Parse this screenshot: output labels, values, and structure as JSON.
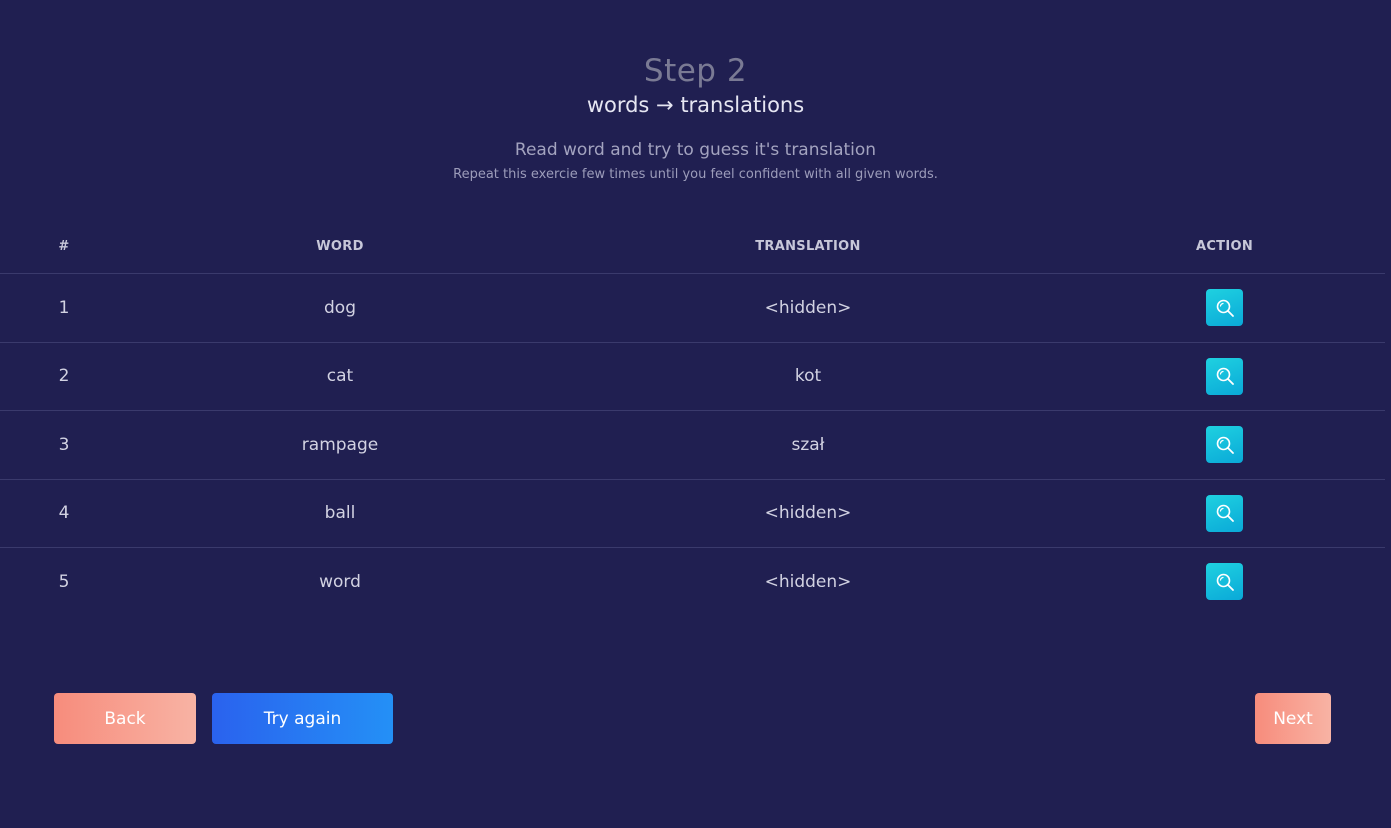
{
  "header": {
    "title": "Step 2",
    "subtitle": "words → translations",
    "instruction": "Read word and try to guess it's translation",
    "hint": "Repeat this exercie few times until you feel confident with all given words."
  },
  "table": {
    "columns": [
      "#",
      "WORD",
      "TRANSLATION",
      "ACTION"
    ],
    "rows": [
      {
        "num": "1",
        "word": "dog",
        "translation": "<hidden>",
        "action_icon": "search-icon"
      },
      {
        "num": "2",
        "word": "cat",
        "translation": "kot",
        "action_icon": "search-icon"
      },
      {
        "num": "3",
        "word": "rampage",
        "translation": "szał",
        "action_icon": "search-icon"
      },
      {
        "num": "4",
        "word": "ball",
        "translation": "<hidden>",
        "action_icon": "search-icon"
      },
      {
        "num": "5",
        "word": "word",
        "translation": "<hidden>",
        "action_icon": "search-icon"
      }
    ]
  },
  "buttons": {
    "back": "Back",
    "try_again": "Try again",
    "next": "Next"
  },
  "colors": {
    "background": "#201f51",
    "action_button": "#12bedc",
    "back_next_button": "#f8a091",
    "try_again_button": "#2a77f2"
  }
}
